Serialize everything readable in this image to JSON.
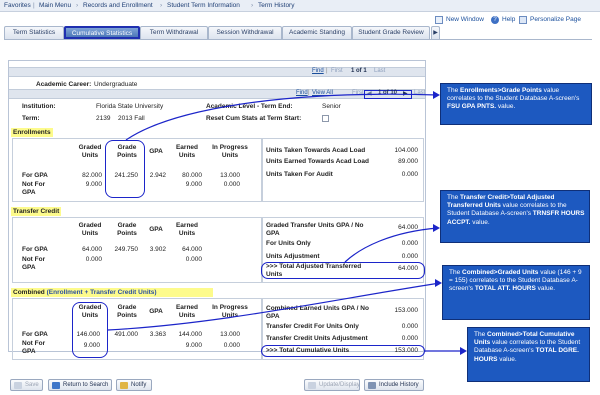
{
  "topnav": {
    "items": [
      "Favorites",
      "Main Menu",
      "Records and Enrollment",
      "Student Term Information",
      "Term History"
    ]
  },
  "toolbar": {
    "new_window": "New Window",
    "help": "Help",
    "personalize": "Personalize Page"
  },
  "tabs": [
    "Term Statistics",
    "Cumulative Statistics",
    "Term Withdrawal",
    "Session Withdrawal",
    "Academic Standing",
    "Student Grade Review"
  ],
  "career_nav": {
    "find": "Find",
    "view_all": "View All",
    "first": "First",
    "pager": "1 of 1",
    "last": "Last"
  },
  "academic_career_label": "Academic Career:",
  "academic_career_value": "Undergraduate",
  "term_nav": {
    "find": "Find",
    "view_all": "View All",
    "first": "First",
    "pager": "1 of 10",
    "last": "Last"
  },
  "institution_label": "Institution:",
  "institution_value": "Florida State University",
  "term_label": "Term:",
  "term_code": "2139",
  "term_name": "2013 Fall",
  "academic_level_label": "Academic Level - Term End:",
  "academic_level_value": "Senior",
  "reset_cum_label": "Reset Cum Stats at Term Start:",
  "enrollments": {
    "title": "Enrollments",
    "headers": {
      "graded": [
        "Graded",
        "Units"
      ],
      "grade_points": [
        "Grade",
        "Points"
      ],
      "gpa": "GPA",
      "earned": [
        "Earned",
        "Units"
      ],
      "inprog": [
        "In Progress",
        "Units"
      ]
    },
    "for_gpa_label": "For GPA",
    "not_for_gpa_label": [
      "Not For",
      "GPA"
    ],
    "for_gpa": {
      "graded": "82.000",
      "grade_points": "241.250",
      "gpa": "2.942",
      "earned": "80.000",
      "inprog": "13.000"
    },
    "not_for_gpa": {
      "graded": "9.000",
      "earned": "9.000",
      "inprog": "0.000"
    },
    "right": [
      {
        "label": "Units Taken Towards Acad Load",
        "value": "104.000"
      },
      {
        "label": "Units Earned Towards Acad Load",
        "value": "89.000"
      },
      {
        "label": "Units Taken For Audit",
        "value": "0.000"
      }
    ]
  },
  "transfer": {
    "title": "Transfer Credit",
    "headers": {
      "graded": [
        "Graded",
        "Units"
      ],
      "grade_points": [
        "Grade",
        "Points"
      ],
      "gpa": "GPA",
      "earned": [
        "Earned",
        "Units"
      ]
    },
    "for_gpa_label": "For GPA",
    "not_for_gpa_label": [
      "Not For",
      "GPA"
    ],
    "for_gpa": {
      "graded": "64.000",
      "grade_points": "249.750",
      "gpa": "3.902",
      "earned": "64.000"
    },
    "not_for_gpa": {
      "graded": "0.000",
      "earned": "0.000"
    },
    "right": [
      {
        "label": [
          "Graded Transfer Units GPA / No",
          "GPA"
        ],
        "value": "64.000"
      },
      {
        "label": "For Units Only",
        "value": "0.000"
      },
      {
        "label": "Units Adjustment",
        "value": "0.000"
      },
      {
        "label": [
          ">>> Total Adjusted Transferred",
          "Units"
        ],
        "value": "64.000"
      }
    ]
  },
  "combined": {
    "title": "Combined",
    "subtitle": "(Enrollment + Transfer Credit Units)",
    "headers": {
      "graded": [
        "Graded",
        "Units"
      ],
      "grade_points": [
        "Grade",
        "Points"
      ],
      "gpa": "GPA",
      "earned": [
        "Earned",
        "Units"
      ],
      "inprog": [
        "In Progress",
        "Units"
      ]
    },
    "for_gpa_label": "For GPA",
    "not_for_gpa_label": [
      "Not For",
      "GPA"
    ],
    "for_gpa": {
      "graded": "146.000",
      "grade_points": "491.000",
      "gpa": "3.363",
      "earned": "144.000",
      "inprog": "13.000"
    },
    "not_for_gpa": {
      "graded": "9.000",
      "earned": "9.000",
      "inprog": "0.000"
    },
    "right": [
      {
        "label": [
          "Combined Earned Units GPA / No",
          "GPA"
        ],
        "value": "153.000"
      },
      {
        "label": "Transfer Credit For Units Only",
        "value": "0.000"
      },
      {
        "label": "Transfer Credit Units Adjustment",
        "value": "0.000"
      },
      {
        "label": ">>> Total Cumulative Units",
        "value": "153.000"
      }
    ]
  },
  "buttons": {
    "save": "Save",
    "return": "Return to Search",
    "notify": "Notify",
    "update": "Update/Display",
    "include_history": "Include History"
  },
  "callouts": {
    "c1": [
      "The ",
      "Enrollments>Grade Points",
      " value correlates to the Student Database A-screen's ",
      "FSU GPA PNTS.",
      " value."
    ],
    "c2": [
      "The ",
      "Transfer Credit>Total Adjusted Transferred Units",
      " value correlates to the Student Database A-screen's ",
      "TRNSFR HOURS ACCPT.",
      " value."
    ],
    "c3": [
      "The ",
      "Combined>Graded Units",
      " value (146 + 9 = 155) correlates to the Student Database A-screen's ",
      "TOTAL ATT. HOURS",
      " value."
    ],
    "c4": [
      "The ",
      "Combined>Total Cumulative Units",
      " value correlates to the Student Database A-screen's ",
      "TOTAL DGRE. HOURS",
      " value."
    ]
  },
  "colors": {
    "callout": "#1d59c0",
    "oval": "#1c25c9",
    "section_highlight": "#fdfb8c",
    "link": "#1b4f9c"
  }
}
